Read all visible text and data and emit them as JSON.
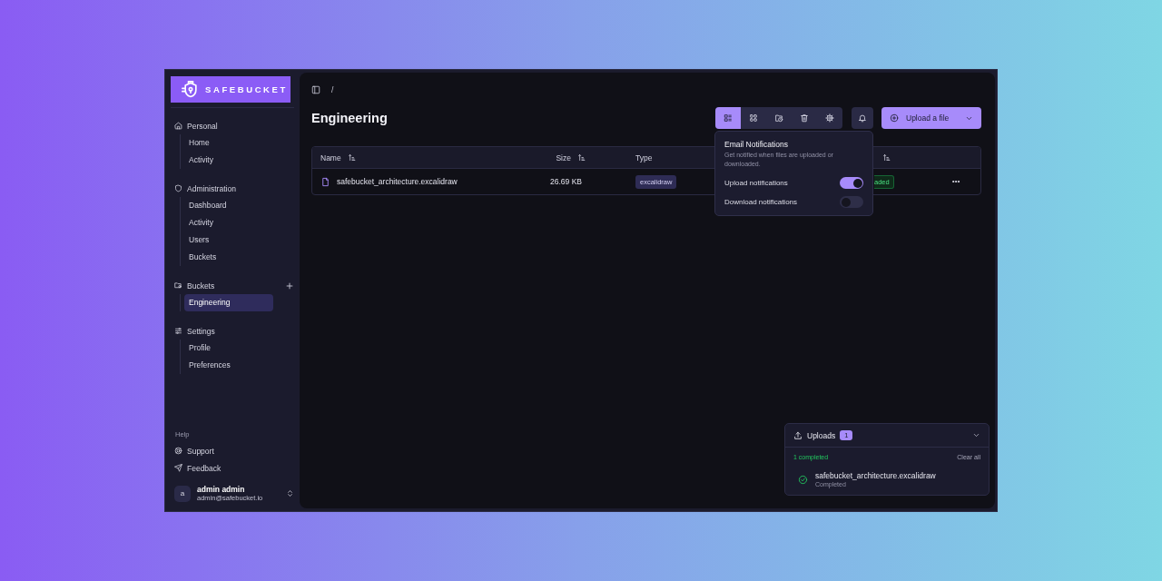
{
  "brand": {
    "name": "SAFEBUCKET"
  },
  "sidebar": {
    "groups": [
      {
        "label": "Personal",
        "addable": false,
        "items": [
          {
            "label": "Home",
            "selected": false
          },
          {
            "label": "Activity",
            "selected": false
          }
        ]
      },
      {
        "label": "Administration",
        "addable": false,
        "items": [
          {
            "label": "Dashboard",
            "selected": false
          },
          {
            "label": "Activity",
            "selected": false
          },
          {
            "label": "Users",
            "selected": false
          },
          {
            "label": "Buckets",
            "selected": false
          }
        ]
      },
      {
        "label": "Buckets",
        "addable": true,
        "items": [
          {
            "label": "Engineering",
            "selected": true
          }
        ]
      },
      {
        "label": "Settings",
        "addable": false,
        "items": [
          {
            "label": "Profile",
            "selected": false
          },
          {
            "label": "Preferences",
            "selected": false
          }
        ]
      }
    ],
    "help": {
      "label": "Help",
      "items": [
        {
          "label": "Support"
        },
        {
          "label": "Feedback"
        }
      ]
    },
    "user": {
      "avatar": "a",
      "name": "admin admin",
      "email": "admin@safebucket.io"
    }
  },
  "breadcrumb": "/",
  "title": "Engineering",
  "toolbar": {
    "views": [
      {
        "selected": true
      },
      {
        "selected": false
      },
      {
        "selected": false
      },
      {
        "selected": false
      },
      {
        "selected": false
      }
    ],
    "upload_button": "Upload a file"
  },
  "table": {
    "columns": [
      {
        "label": "Name",
        "sortable": true
      },
      {
        "label": "Size",
        "sortable": true
      },
      {
        "label": "Type",
        "sortable": false
      },
      {
        "sortable": true
      }
    ],
    "rows": [
      {
        "name": "safebucket_architecture.excalidraw",
        "size": "26.69 KB",
        "type": "excalidraw",
        "status": "aded"
      }
    ]
  },
  "notifications": {
    "title": "Email Notifications",
    "description": "Get notified when files are uploaded or downloaded.",
    "toggles": [
      {
        "label": "Upload notifications",
        "on": true
      },
      {
        "label": "Download notifications",
        "on": false
      }
    ]
  },
  "uploads": {
    "title": "Uploads",
    "count": "1",
    "summary": "1 completed",
    "clear": "Clear all",
    "expanded": true,
    "items": [
      {
        "name": "safebucket_architecture.excalidraw",
        "status": "Completed"
      }
    ]
  }
}
